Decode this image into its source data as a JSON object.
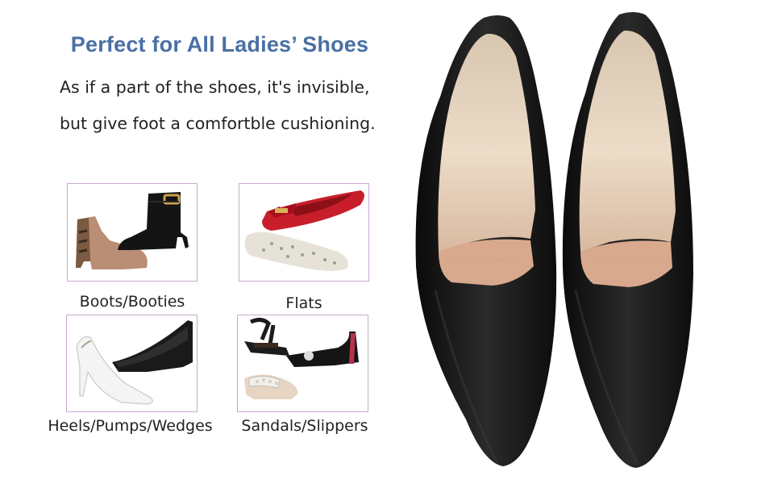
{
  "headline": "Perfect for All Ladies’ Shoes",
  "description": {
    "line1": "As if a part of the shoes, it's invisible,",
    "line2": "but give foot a comfortble cushioning."
  },
  "categories": [
    {
      "label": "Boots/Booties",
      "icon": "boots-photo"
    },
    {
      "label": "Flats",
      "icon": "flats-photo"
    },
    {
      "label": "Heels/Pumps/Wedges",
      "icon": "heels-photo"
    },
    {
      "label": "Sandals/Slippers",
      "icon": "sandals-photo"
    }
  ],
  "colors": {
    "headline": "#4a6fa5",
    "card_border": "#c9a9cf",
    "shoe_black": "#151515",
    "insole": "#e6d3bd"
  }
}
